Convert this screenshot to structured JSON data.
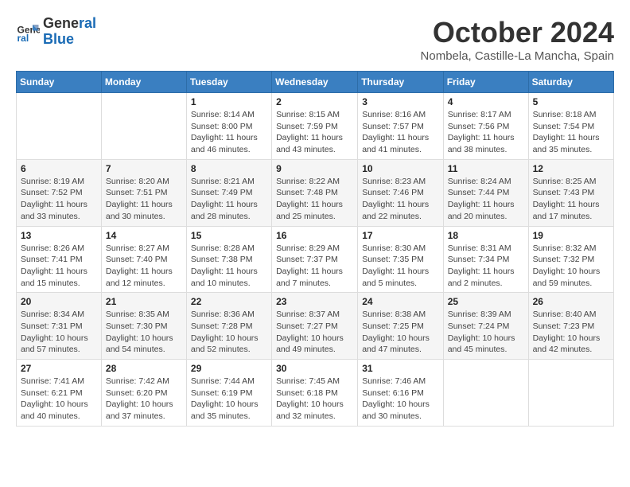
{
  "logo": {
    "line1": "General",
    "line2": "Blue"
  },
  "title": "October 2024",
  "subtitle": "Nombela, Castille-La Mancha, Spain",
  "days_of_week": [
    "Sunday",
    "Monday",
    "Tuesday",
    "Wednesday",
    "Thursday",
    "Friday",
    "Saturday"
  ],
  "weeks": [
    [
      {
        "day": "",
        "details": ""
      },
      {
        "day": "",
        "details": ""
      },
      {
        "day": "1",
        "details": "Sunrise: 8:14 AM\nSunset: 8:00 PM\nDaylight: 11 hours and 46 minutes."
      },
      {
        "day": "2",
        "details": "Sunrise: 8:15 AM\nSunset: 7:59 PM\nDaylight: 11 hours and 43 minutes."
      },
      {
        "day": "3",
        "details": "Sunrise: 8:16 AM\nSunset: 7:57 PM\nDaylight: 11 hours and 41 minutes."
      },
      {
        "day": "4",
        "details": "Sunrise: 8:17 AM\nSunset: 7:56 PM\nDaylight: 11 hours and 38 minutes."
      },
      {
        "day": "5",
        "details": "Sunrise: 8:18 AM\nSunset: 7:54 PM\nDaylight: 11 hours and 35 minutes."
      }
    ],
    [
      {
        "day": "6",
        "details": "Sunrise: 8:19 AM\nSunset: 7:52 PM\nDaylight: 11 hours and 33 minutes."
      },
      {
        "day": "7",
        "details": "Sunrise: 8:20 AM\nSunset: 7:51 PM\nDaylight: 11 hours and 30 minutes."
      },
      {
        "day": "8",
        "details": "Sunrise: 8:21 AM\nSunset: 7:49 PM\nDaylight: 11 hours and 28 minutes."
      },
      {
        "day": "9",
        "details": "Sunrise: 8:22 AM\nSunset: 7:48 PM\nDaylight: 11 hours and 25 minutes."
      },
      {
        "day": "10",
        "details": "Sunrise: 8:23 AM\nSunset: 7:46 PM\nDaylight: 11 hours and 22 minutes."
      },
      {
        "day": "11",
        "details": "Sunrise: 8:24 AM\nSunset: 7:44 PM\nDaylight: 11 hours and 20 minutes."
      },
      {
        "day": "12",
        "details": "Sunrise: 8:25 AM\nSunset: 7:43 PM\nDaylight: 11 hours and 17 minutes."
      }
    ],
    [
      {
        "day": "13",
        "details": "Sunrise: 8:26 AM\nSunset: 7:41 PM\nDaylight: 11 hours and 15 minutes."
      },
      {
        "day": "14",
        "details": "Sunrise: 8:27 AM\nSunset: 7:40 PM\nDaylight: 11 hours and 12 minutes."
      },
      {
        "day": "15",
        "details": "Sunrise: 8:28 AM\nSunset: 7:38 PM\nDaylight: 11 hours and 10 minutes."
      },
      {
        "day": "16",
        "details": "Sunrise: 8:29 AM\nSunset: 7:37 PM\nDaylight: 11 hours and 7 minutes."
      },
      {
        "day": "17",
        "details": "Sunrise: 8:30 AM\nSunset: 7:35 PM\nDaylight: 11 hours and 5 minutes."
      },
      {
        "day": "18",
        "details": "Sunrise: 8:31 AM\nSunset: 7:34 PM\nDaylight: 11 hours and 2 minutes."
      },
      {
        "day": "19",
        "details": "Sunrise: 8:32 AM\nSunset: 7:32 PM\nDaylight: 10 hours and 59 minutes."
      }
    ],
    [
      {
        "day": "20",
        "details": "Sunrise: 8:34 AM\nSunset: 7:31 PM\nDaylight: 10 hours and 57 minutes."
      },
      {
        "day": "21",
        "details": "Sunrise: 8:35 AM\nSunset: 7:30 PM\nDaylight: 10 hours and 54 minutes."
      },
      {
        "day": "22",
        "details": "Sunrise: 8:36 AM\nSunset: 7:28 PM\nDaylight: 10 hours and 52 minutes."
      },
      {
        "day": "23",
        "details": "Sunrise: 8:37 AM\nSunset: 7:27 PM\nDaylight: 10 hours and 49 minutes."
      },
      {
        "day": "24",
        "details": "Sunrise: 8:38 AM\nSunset: 7:25 PM\nDaylight: 10 hours and 47 minutes."
      },
      {
        "day": "25",
        "details": "Sunrise: 8:39 AM\nSunset: 7:24 PM\nDaylight: 10 hours and 45 minutes."
      },
      {
        "day": "26",
        "details": "Sunrise: 8:40 AM\nSunset: 7:23 PM\nDaylight: 10 hours and 42 minutes."
      }
    ],
    [
      {
        "day": "27",
        "details": "Sunrise: 7:41 AM\nSunset: 6:21 PM\nDaylight: 10 hours and 40 minutes."
      },
      {
        "day": "28",
        "details": "Sunrise: 7:42 AM\nSunset: 6:20 PM\nDaylight: 10 hours and 37 minutes."
      },
      {
        "day": "29",
        "details": "Sunrise: 7:44 AM\nSunset: 6:19 PM\nDaylight: 10 hours and 35 minutes."
      },
      {
        "day": "30",
        "details": "Sunrise: 7:45 AM\nSunset: 6:18 PM\nDaylight: 10 hours and 32 minutes."
      },
      {
        "day": "31",
        "details": "Sunrise: 7:46 AM\nSunset: 6:16 PM\nDaylight: 10 hours and 30 minutes."
      },
      {
        "day": "",
        "details": ""
      },
      {
        "day": "",
        "details": ""
      }
    ]
  ]
}
